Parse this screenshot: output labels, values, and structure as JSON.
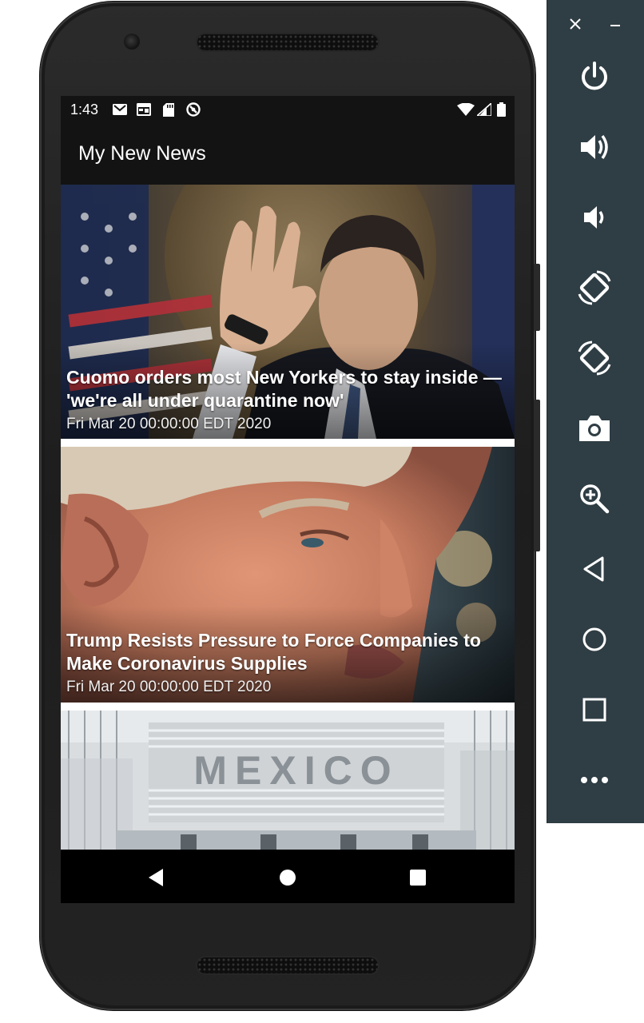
{
  "status_bar": {
    "time": "1:43",
    "left_icons": [
      "gmail-icon",
      "calendar-icon",
      "sd-card-icon",
      "sync-icon"
    ],
    "right_icons": [
      "wifi-icon",
      "cell-signal-icon",
      "battery-icon"
    ]
  },
  "app_bar": {
    "title": "My New News"
  },
  "articles": [
    {
      "title": "Cuomo orders most New Yorkers to stay inside — 'we're all under quarantine now'",
      "date": "Fri Mar 20 00:00:00 EDT 2020",
      "image": "cuomo-photo"
    },
    {
      "title": "Trump Resists Pressure to Force Companies to Make Coronavirus Supplies",
      "date": "Fri Mar 20 00:00:00 EDT 2020",
      "image": "trump-photo"
    },
    {
      "title": "",
      "date": "",
      "image": "mexico-border-photo",
      "photo_text": "MEXICO"
    }
  ],
  "nav_bar": {
    "buttons": [
      "back-icon",
      "home-icon",
      "recents-icon"
    ]
  },
  "emulator_toolbar": {
    "window_controls": [
      "close-icon",
      "minimize-icon"
    ],
    "buttons": [
      "power-icon",
      "volume-up-icon",
      "volume-down-icon",
      "rotate-left-icon",
      "rotate-right-icon",
      "camera-icon",
      "zoom-icon",
      "back-icon",
      "home-icon",
      "overview-icon",
      "more-icon"
    ]
  },
  "colors": {
    "toolbar_bg": "#2f3d44",
    "appbar_bg": "#131313",
    "navbar_bg": "#000000"
  }
}
